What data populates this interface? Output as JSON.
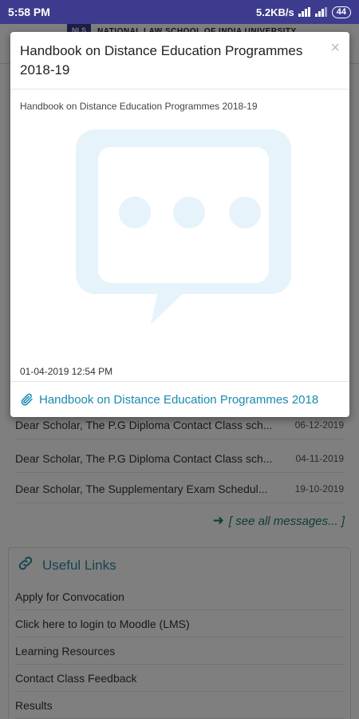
{
  "status_bar": {
    "time": "5:58 PM",
    "net_speed": "5.2KB/s",
    "battery": "44"
  },
  "background": {
    "university_name": "NATIONAL LAW SCHOOL OF INDIA UNIVERSITY",
    "messages": [
      {
        "text": "Dear Scholar, The P.G Diploma Contact Class sch...",
        "date": "06-12-2019"
      },
      {
        "text": "Dear Scholar, The P.G Diploma Contact Class sch...",
        "date": "04-11-2019"
      },
      {
        "text": "Dear Scholar, The Supplementary Exam Schedul...",
        "date": "19-10-2019"
      }
    ],
    "see_all": "[ see all messages... ]",
    "useful_links_title": "Useful Links",
    "useful_links": [
      "Apply for Convocation",
      "Click here to login to Moodle (LMS)",
      "Learning Resources",
      "Contact Class Feedback",
      "Results"
    ]
  },
  "modal": {
    "title": "Handbook on Distance Education Programmes 2018-19",
    "close_label": "×",
    "subtitle": "Handbook on Distance Education Programmes 2018-19",
    "timestamp": "01-04-2019 12:54 PM",
    "attachment_label": "Handbook on Distance Education Programmes 2018"
  },
  "colors": {
    "status_bar": "#3d3b8e",
    "accent_teal": "#1a7a6e",
    "link_blue": "#1a8ab0",
    "placeholder_blue": "#e6f3fb"
  },
  "icons": {
    "close": "close-icon",
    "attachment": "paperclip-icon",
    "links": "link-icon",
    "arrow": "arrow-right-icon",
    "placeholder": "chat-bubble-icon"
  }
}
